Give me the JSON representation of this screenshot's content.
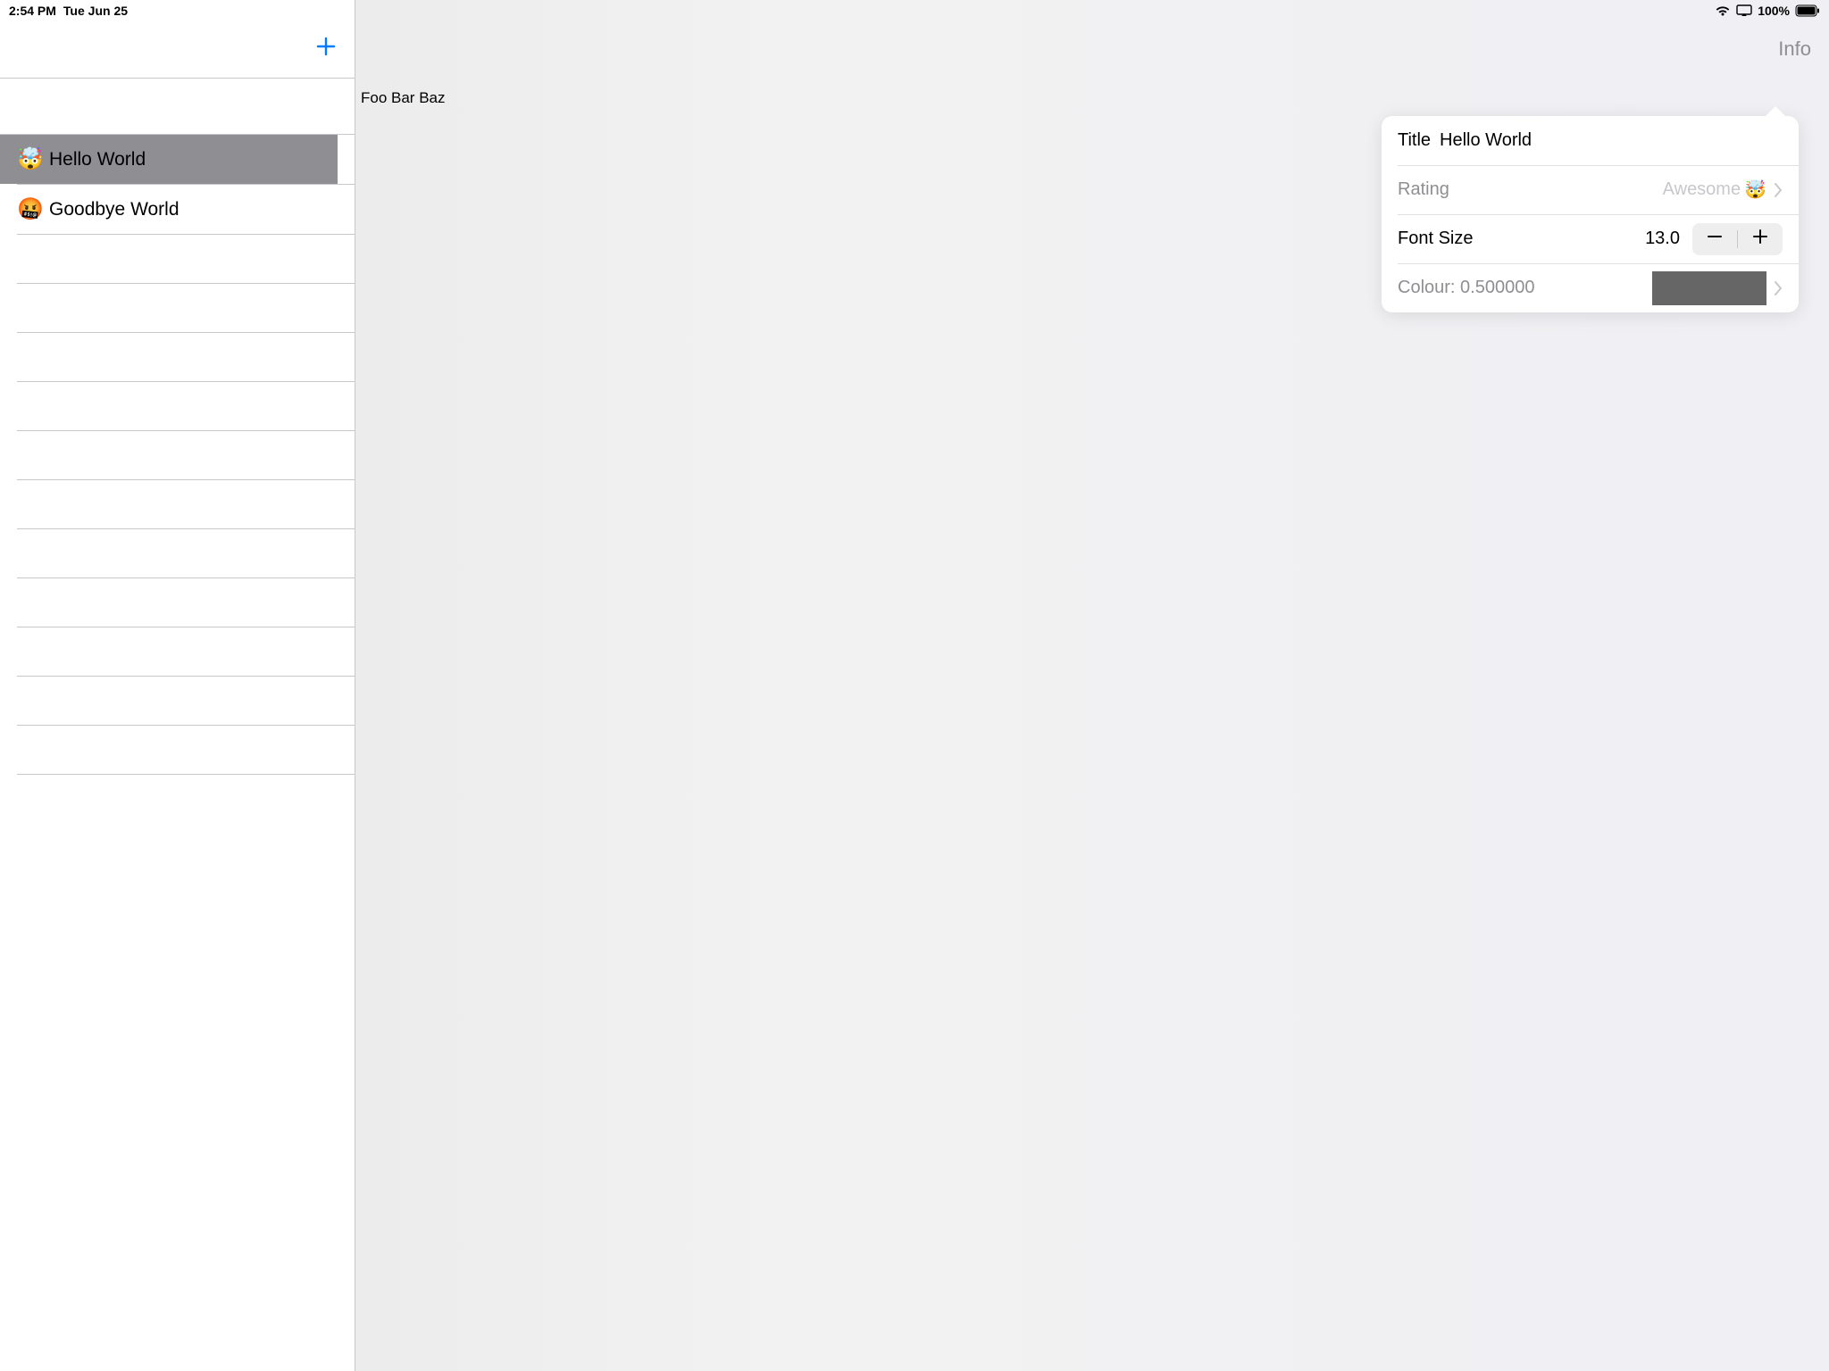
{
  "status_bar": {
    "time": "2:54 PM",
    "date": "Tue Jun 25",
    "battery_pct": "100%"
  },
  "detail": {
    "nav_button": "Info",
    "body_text": "Foo Bar Baz"
  },
  "list": {
    "items": [
      {
        "emoji": "🤯",
        "label": "Hello World",
        "selected": true
      },
      {
        "emoji": "🤬",
        "label": "Goodbye World",
        "selected": false
      }
    ]
  },
  "popover": {
    "title_label": "Title",
    "title_value": "Hello World",
    "rating_label": "Rating",
    "rating_value": "Awesome",
    "rating_emoji": "🤯",
    "fontsize_label": "Font Size",
    "fontsize_value": "13.0",
    "colour_label": "Colour: 0.500000",
    "colour_swatch": "#666666"
  }
}
